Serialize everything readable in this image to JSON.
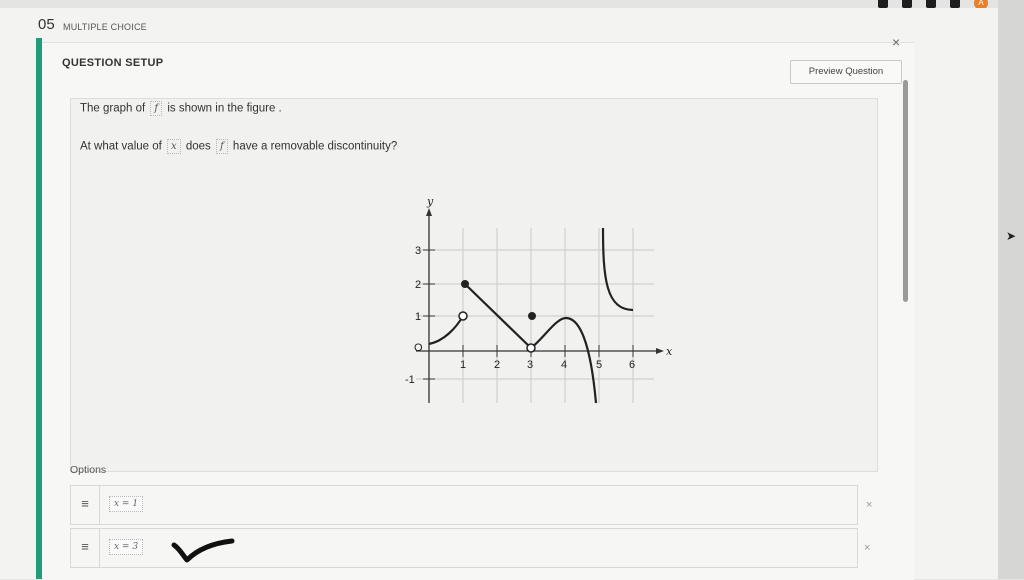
{
  "question": {
    "number": "05",
    "type": "MULTIPLE CHOICE",
    "setup_title": "QUESTION SETUP",
    "close_label": "×",
    "preview_button": "Preview Question",
    "line1": {
      "prefix": "The graph of",
      "var": "f",
      "suffix": "is shown in the figure ."
    },
    "line2": {
      "prefix": "At what value of",
      "var_x": "x",
      "middle": "does",
      "var_f": "f",
      "suffix": "have a removable discontinuity?"
    }
  },
  "graph": {
    "y_axis_label": "y",
    "x_axis_label": "x",
    "origin_label": "O",
    "x_ticks": [
      "1",
      "2",
      "3",
      "4",
      "5",
      "6"
    ],
    "y_ticks": [
      "3",
      "2",
      "1",
      "-1"
    ]
  },
  "options": {
    "label": "Options",
    "items": [
      {
        "handle": "≡",
        "text": "x = 1",
        "remove": "×"
      },
      {
        "handle": "≡",
        "text": "x = 3",
        "remove": "×"
      }
    ]
  },
  "topbar": {
    "avatar_letter": "A"
  }
}
